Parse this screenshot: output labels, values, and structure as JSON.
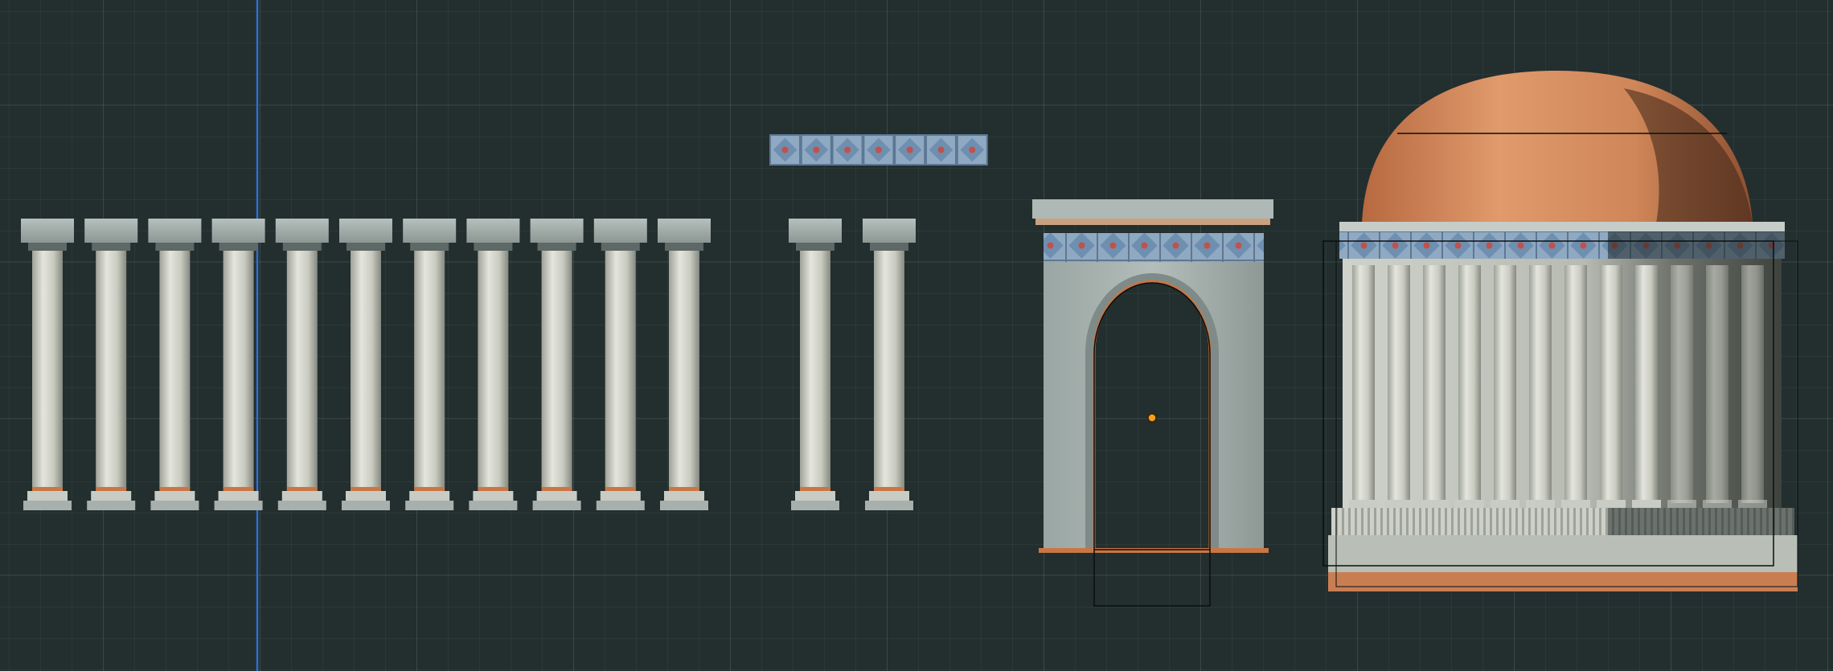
{
  "viewport": {
    "name": "3d-viewport",
    "view": "front orthographic"
  },
  "colors": {
    "background": "#232e2e",
    "grid_line": "#31403f",
    "axis_line": "#2f6fd0",
    "stone": "#a3aeaa",
    "stone_dark": "#7d8885",
    "marble_column": "#d6d8cf",
    "terracotta": "#d3885a",
    "tile_blue": "#8aa7c4",
    "tile_red": "#c0524a",
    "origin_dot": "#f3a020",
    "wire": "#0b0f0f"
  },
  "objects": {
    "columns_row": {
      "count": 11,
      "label": "column"
    },
    "columns_pair": {
      "count": 2,
      "label": "column"
    },
    "tile_frieze": {
      "tiles": 7,
      "label": "tile-frieze"
    },
    "arch": {
      "label": "arched-doorway",
      "frieze_tiles": 7,
      "selected": true
    },
    "temple": {
      "label": "domed-temple",
      "columns": 12
    }
  }
}
